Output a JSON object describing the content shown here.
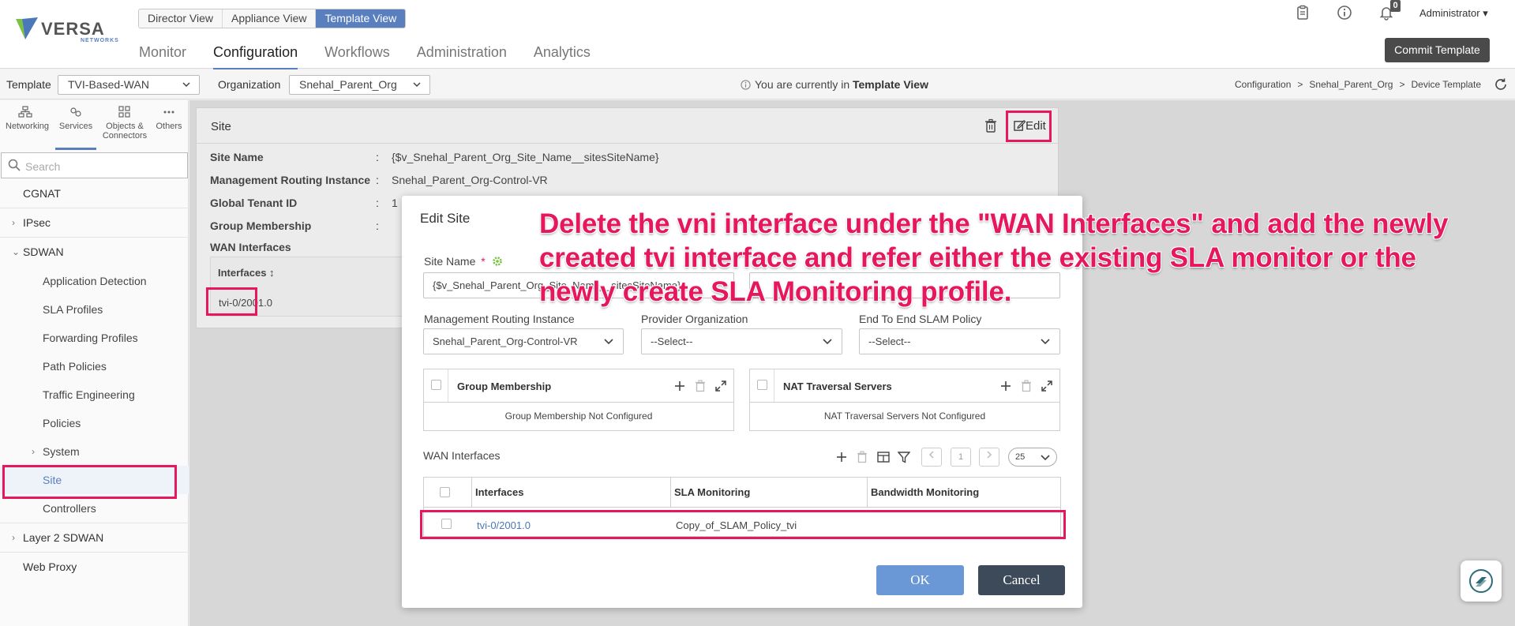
{
  "header": {
    "logo_text": "VERSA",
    "logo_sub": "NETWORKS",
    "view_tabs": [
      "Director View",
      "Appliance View",
      "Template View"
    ],
    "main_nav": [
      "Monitor",
      "Configuration",
      "Workflows",
      "Administration",
      "Analytics"
    ],
    "notification_count": "0",
    "user": "Administrator ▾",
    "commit_label": "Commit Template"
  },
  "template_bar": {
    "template_label": "Template",
    "template_value": "TVI-Based-WAN",
    "org_label": "Organization",
    "org_value": "Snehal_Parent_Org",
    "info_prefix": "You are currently in ",
    "info_bold": "Template View",
    "breadcrumb": [
      "Configuration",
      "Snehal_Parent_Org",
      "Device Template"
    ],
    "breadcrumb_sep": ">"
  },
  "sidebar": {
    "tabs": [
      "Networking",
      "Services",
      "Objects &",
      "Connectors",
      "Others"
    ],
    "search_placeholder": "Search",
    "items": {
      "cgnat": "CGNAT",
      "ipsec": "IPsec",
      "sdwan": "SDWAN",
      "app_detection": "Application Detection",
      "sla_profiles": "SLA Profiles",
      "forwarding_profiles": "Forwarding Profiles",
      "path_policies": "Path Policies",
      "traffic_engineering": "Traffic Engineering",
      "policies": "Policies",
      "system": "System",
      "site": "Site",
      "controllers": "Controllers",
      "layer2": "Layer 2 SDWAN",
      "web_proxy": "Web Proxy"
    }
  },
  "site_card": {
    "title": "Site",
    "edit_label": "Edit",
    "rows": [
      {
        "key": "Site Name",
        "value": "{$v_Snehal_Parent_Org_Site_Name__sitesSiteName}"
      },
      {
        "key": "Management Routing Instance",
        "value": "Snehal_Parent_Org-Control-VR"
      },
      {
        "key": "Global Tenant ID",
        "value": "1"
      },
      {
        "key": "Group Membership",
        "value": ""
      }
    ],
    "colon": ":",
    "wan_label": "WAN Interfaces",
    "wan_header": "Interfaces ↕",
    "wan_row": "tvi-0/2001.0"
  },
  "modal": {
    "title": "Edit Site",
    "site_name_label": "Site Name",
    "required": "*",
    "site_name_value": "{$v_Snehal_Parent_Org_Site_Name__sitesSiteName}",
    "mgmt_label": "Management Routing Instance",
    "mgmt_value": "Snehal_Parent_Org-Control-VR",
    "provider_label": "Provider Organization",
    "provider_value": "--Select--",
    "slam_label": "End To End SLAM Policy",
    "slam_value": "--Select--",
    "group_title": "Group Membership",
    "group_empty": "Group Membership Not Configured",
    "nat_title": "NAT Traversal Servers",
    "nat_empty": "NAT Traversal Servers Not Configured",
    "wan_title": "WAN Interfaces",
    "page_num": "1",
    "page_size": "25",
    "columns": [
      "Interfaces",
      "SLA Monitoring",
      "Bandwidth Monitoring"
    ],
    "row": {
      "interface": "tvi-0/2001.0",
      "sla": "Copy_of_SLAM_Policy_tvi",
      "bandwidth": ""
    },
    "ok_label": "OK",
    "cancel_label": "Cancel"
  },
  "annotation": {
    "line1": "Delete the vni interface under the \"WAN Interfaces\" and add the newly",
    "line2": "created tvi interface and refer either the existing SLA monitor or the",
    "line3": "newly create SLA Monitoring profile."
  },
  "colors": {
    "accent": "#5a7fbf",
    "highlight": "#e6175c",
    "commit_bg": "#4a4a4a",
    "ok_bg": "#6a98d6",
    "cancel_bg": "#3d4a5a"
  },
  "icons": [
    "clipboard-icon",
    "info-icon",
    "bell-icon",
    "refresh-icon",
    "networking-icon",
    "services-icon",
    "objects-icon",
    "others-icon",
    "search-icon",
    "trash-icon",
    "edit-icon",
    "gear-icon",
    "plus-icon",
    "expand-icon",
    "columns-icon",
    "filter-icon",
    "chevron-down-icon",
    "help-icon"
  ]
}
